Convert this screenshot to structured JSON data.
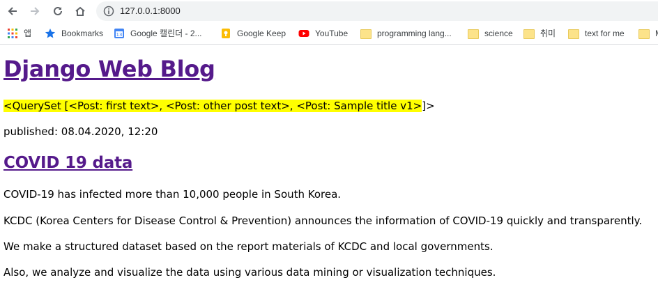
{
  "browser": {
    "url": "127.0.0.1:8000",
    "bookmarks": [
      {
        "label": "앱",
        "icon": "apps-grid-icon"
      },
      {
        "label": "Bookmarks",
        "icon": "star-icon"
      },
      {
        "label": "Google 캘린더 - 2...",
        "icon": "calendar-icon"
      },
      {
        "label": "Google Keep",
        "icon": "keep-icon"
      },
      {
        "label": "YouTube",
        "icon": "youtube-icon"
      },
      {
        "label": "programming lang...",
        "icon": "folder-icon"
      },
      {
        "label": "science",
        "icon": "folder-icon"
      },
      {
        "label": "취미",
        "icon": "folder-icon"
      },
      {
        "label": "text for me",
        "icon": "folder-icon"
      },
      {
        "label": "M",
        "icon": "folder-icon"
      }
    ]
  },
  "page": {
    "site_title": "Django Web Blog",
    "queryset_text": "<QuerySet [<Post: first text>, <Post: other post text>, <Post: Sample title v1>",
    "queryset_tail": "]>",
    "published": "published: 08.04.2020, 12:20",
    "post_title": "COVID 19 data",
    "paragraphs": [
      "COVID-19 has infected more than 10,000 people in South Korea.",
      "KCDC (Korea Centers for Disease Control & Prevention) announces the information of COVID-19 quickly and transparently.",
      "We make a structured dataset based on the report materials of KCDC and local governments.",
      "Also, we analyze and visualize the data using various data mining or visualization techniques."
    ]
  },
  "colors": {
    "link_visited": "#551a8b",
    "highlight": "#ffff00"
  }
}
